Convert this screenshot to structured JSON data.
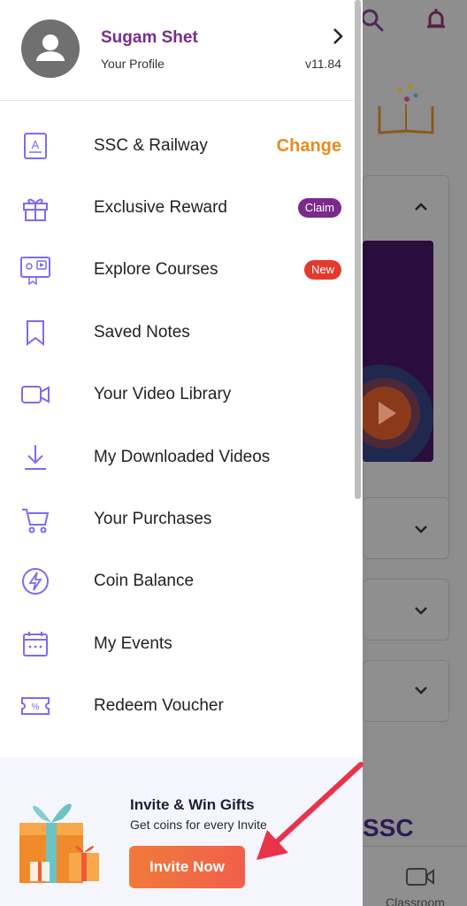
{
  "profile": {
    "name": "Sugam Shet",
    "subtitle": "Your Profile",
    "version": "v11.84"
  },
  "menu": [
    {
      "label": "SSC & Railway",
      "action": "Change",
      "icon": "exam-icon"
    },
    {
      "label": "Exclusive Reward",
      "badge": "Claim",
      "icon": "gift-icon"
    },
    {
      "label": "Explore Courses",
      "badge": "New",
      "icon": "courses-icon"
    },
    {
      "label": "Saved Notes",
      "icon": "bookmark-icon"
    },
    {
      "label": "Your Video Library",
      "icon": "video-camera-icon"
    },
    {
      "label": "My Downloaded Videos",
      "icon": "download-icon"
    },
    {
      "label": "Your Purchases",
      "icon": "cart-icon"
    },
    {
      "label": "Coin Balance",
      "icon": "coin-icon"
    },
    {
      "label": "My Events",
      "icon": "calendar-icon"
    },
    {
      "label": "Redeem Voucher",
      "icon": "voucher-icon"
    }
  ],
  "invite": {
    "title": "Invite & Win Gifts",
    "subtitle": "Get coins for every Invite",
    "button": "Invite Now"
  },
  "background": {
    "section_title": "SSC",
    "tab_label": "Classroom"
  },
  "colors": {
    "accent_purple": "#7b2c8c",
    "change_orange": "#e98a1c",
    "icon_purple": "#7c6cf0",
    "badge_new": "#e5392e",
    "badge_claim": "#7a2a8a",
    "arrow_red": "#e8334a"
  }
}
